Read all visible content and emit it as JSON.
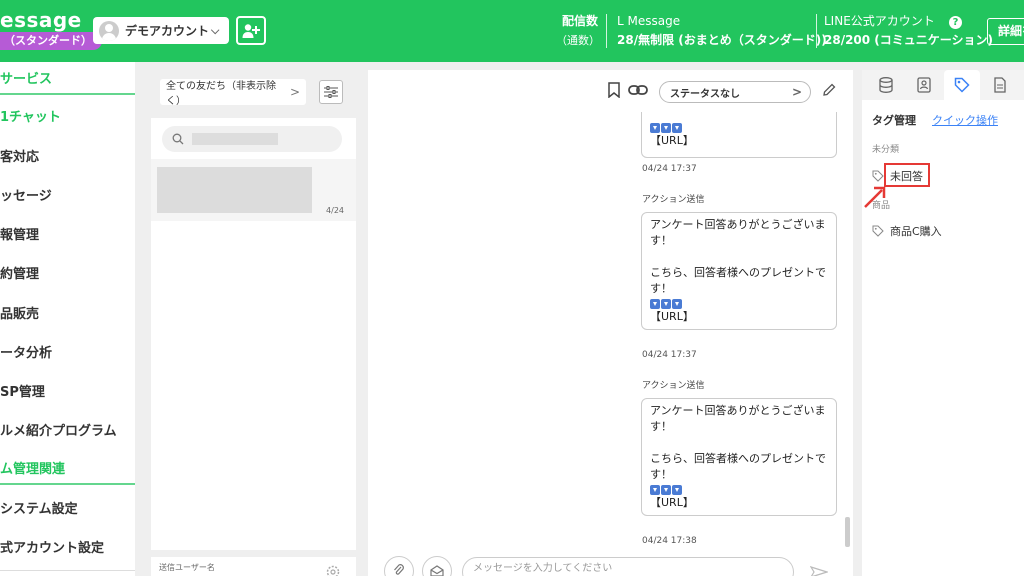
{
  "header": {
    "brand": "essage",
    "plan_badge": "（スタンダード）",
    "account_name": "デモアカウント",
    "delivery": {
      "label": "配信数",
      "sublabel": "（通数）",
      "service_name": "L Message",
      "count_text": "28/無制限 (おまとめ（スタンダード))"
    },
    "line_account": {
      "label": "LINE公式アカウント",
      "count_text": "28/200 (コミュニケーション)"
    },
    "help_icon_text": "?",
    "detail_button": "詳細を"
  },
  "sidebar": {
    "items": [
      "サービス",
      "1チャット",
      "客対応",
      "ッセージ",
      "報管理",
      "約管理",
      "品販売",
      "ータ分析",
      "SP管理",
      "ルメ紹介プログラム",
      "ム管理関連",
      "システム設定",
      "式アカウント設定"
    ]
  },
  "friends": {
    "filter_label": "全ての友だち（非表示除く）",
    "filter_arrow": ">",
    "item_date": "4/24",
    "sender_label": "送信ユーザー名"
  },
  "chat": {
    "status_select": "ステータスなし",
    "status_arrow": ">",
    "messages": [
      {
        "url": "【URL】",
        "time": "04/24 17:37"
      },
      {
        "sender": "アクション送信",
        "line1": "アンケート回答ありがとうございます！",
        "line2": "こちら、回答者様へのプレゼントです！",
        "url": "【URL】",
        "time": "04/24 17:37"
      },
      {
        "sender": "アクション送信",
        "line1": "アンケート回答ありがとうございます！",
        "line2": "こちら、回答者様へのプレゼントです！",
        "url": "【URL】",
        "time": "04/24 17:38"
      }
    ],
    "input_placeholder": "メッセージを入力してください"
  },
  "tags": {
    "heading": "タグ管理",
    "quick_link": "クイック操作",
    "categories": [
      {
        "label": "未分類",
        "tag": "未回答"
      },
      {
        "label": "商品",
        "tag": "商品C購入"
      }
    ]
  },
  "colors": {
    "brand_green": "#22c55e",
    "badge_purple": "#b65bd6",
    "highlight_red": "#e53935",
    "link_blue": "#3b82f6"
  }
}
